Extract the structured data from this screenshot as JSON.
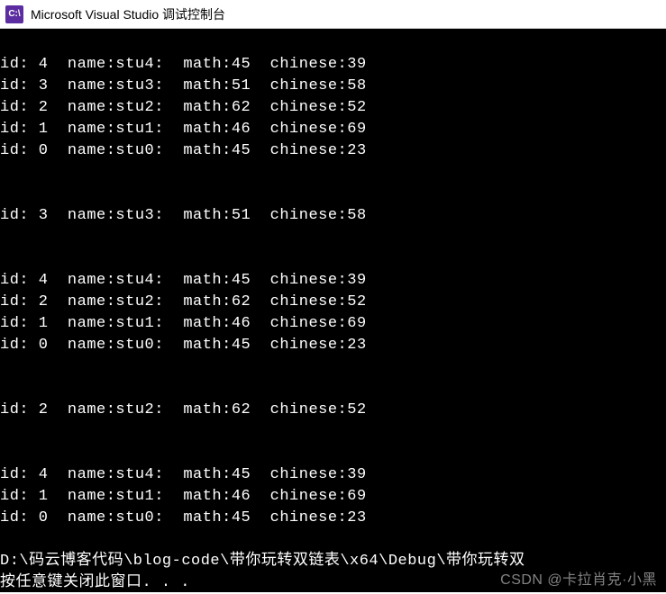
{
  "titlebar": {
    "icon_label": "C:\\",
    "title": "Microsoft Visual Studio 调试控制台"
  },
  "console": {
    "blocks": [
      {
        "rows": [
          {
            "id": 4,
            "name": "stu4",
            "math": 45,
            "chinese": 39
          },
          {
            "id": 3,
            "name": "stu3",
            "math": 51,
            "chinese": 58
          },
          {
            "id": 2,
            "name": "stu2",
            "math": 62,
            "chinese": 52
          },
          {
            "id": 1,
            "name": "stu1",
            "math": 46,
            "chinese": 69
          },
          {
            "id": 0,
            "name": "stu0",
            "math": 45,
            "chinese": 23
          }
        ]
      },
      {
        "rows": [
          {
            "id": 3,
            "name": "stu3",
            "math": 51,
            "chinese": 58
          }
        ]
      },
      {
        "rows": [
          {
            "id": 4,
            "name": "stu4",
            "math": 45,
            "chinese": 39
          },
          {
            "id": 2,
            "name": "stu2",
            "math": 62,
            "chinese": 52
          },
          {
            "id": 1,
            "name": "stu1",
            "math": 46,
            "chinese": 69
          },
          {
            "id": 0,
            "name": "stu0",
            "math": 45,
            "chinese": 23
          }
        ]
      },
      {
        "rows": [
          {
            "id": 2,
            "name": "stu2",
            "math": 62,
            "chinese": 52
          }
        ]
      },
      {
        "rows": [
          {
            "id": 4,
            "name": "stu4",
            "math": 45,
            "chinese": 39
          },
          {
            "id": 1,
            "name": "stu1",
            "math": 46,
            "chinese": 69
          },
          {
            "id": 0,
            "name": "stu0",
            "math": 45,
            "chinese": 23
          }
        ]
      }
    ],
    "path_line": "D:\\码云博客代码\\blog-code\\带你玩转双链表\\x64\\Debug\\带你玩转双",
    "close_prompt": "按任意键关闭此窗口. . .",
    "row_format": "id: {id}  name:{name}:  math:{math}  chinese:{chinese}"
  },
  "watermark": "CSDN @卡拉肖克·小黑"
}
